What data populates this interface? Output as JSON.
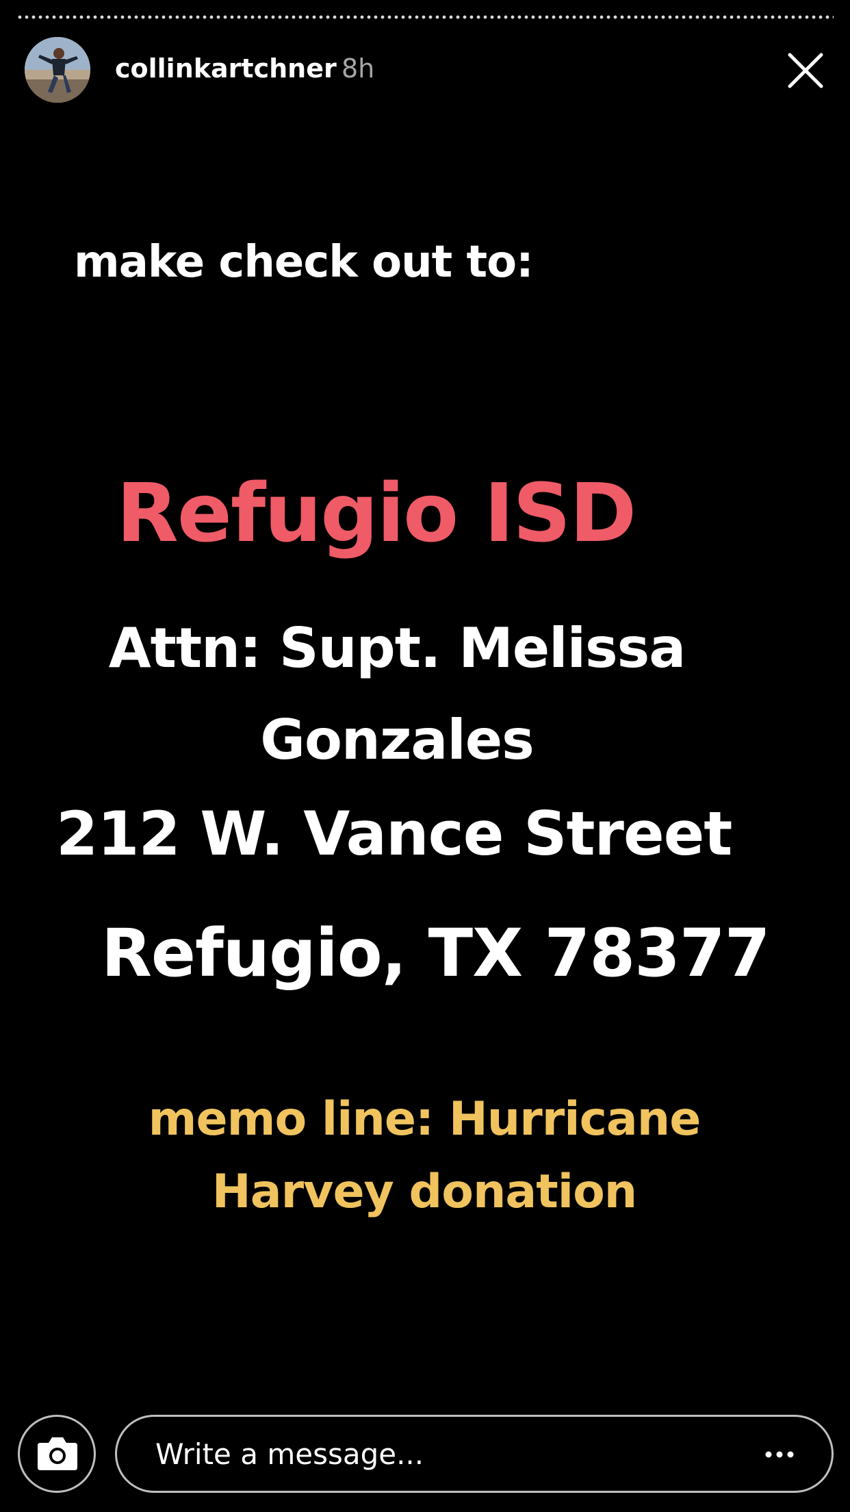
{
  "header": {
    "username": "collinkartchner",
    "time_ago": "8h",
    "avatar_icon": "profile-photo",
    "close_icon": "close-icon"
  },
  "story": {
    "line1": "make check out to:",
    "org_name": "Refugio ISD",
    "attn": "Attn: Supt. Melissa Gonzales",
    "street": "212 W. Vance Street",
    "city": "Refugio, TX  78377",
    "memo": "memo line: Hurricane Harvey donation",
    "colors": {
      "background": "#000000",
      "primary_text": "#ffffff",
      "org_name": "#ef5b67",
      "memo": "#f0c35e"
    }
  },
  "composer": {
    "camera_icon": "camera-icon",
    "placeholder": "Write a message...",
    "more_icon": "more-options-icon"
  }
}
